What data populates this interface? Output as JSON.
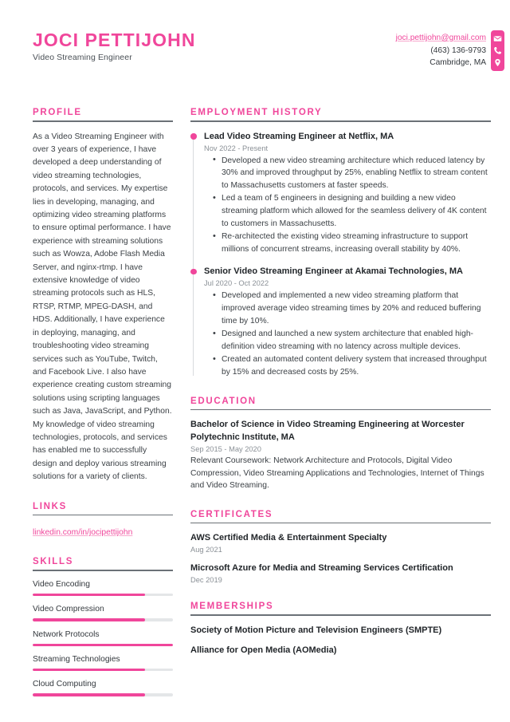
{
  "theme": {
    "accent": "#f0469b",
    "rule": "#6b7177",
    "body_text": "#3b4045",
    "muted_text": "#8a9096",
    "track": "#e4e6e8"
  },
  "header": {
    "full_name": "JOCI PETTIJOHN",
    "job_title": "Video Streaming Engineer",
    "contact": {
      "email": "joci.pettijohn@gmail.com",
      "phone": "(463) 136-9793",
      "location": "Cambridge, MA",
      "icons": [
        "envelope-icon",
        "phone-icon",
        "location-pin-icon"
      ]
    }
  },
  "sidebar": {
    "profile": {
      "heading": "PROFILE",
      "text": "As a Video Streaming Engineer with over 3 years of experience, I have developed a deep understanding of video streaming technologies, protocols, and services. My expertise lies in developing, managing, and optimizing video streaming platforms to ensure optimal performance. I have experience with streaming solutions such as Wowza, Adobe Flash Media Server, and nginx-rtmp. I have extensive knowledge of video streaming protocols such as HLS, RTSP, RTMP, MPEG-DASH, and HDS. Additionally, I have experience in deploying, managing, and troubleshooting video streaming services such as YouTube, Twitch, and Facebook Live. I also have experience creating custom streaming solutions using scripting languages such as Java, JavaScript, and Python. My knowledge of video streaming technologies, protocols, and services has enabled me to successfully design and deploy various streaming solutions for a variety of clients."
    },
    "links": {
      "heading": "LINKS",
      "items": [
        {
          "label": "linkedin.com/in/jocipettijohn"
        }
      ]
    },
    "skills": {
      "heading": "SKILLS",
      "items": [
        {
          "name": "Video Encoding",
          "level": 80
        },
        {
          "name": "Video Compression",
          "level": 80
        },
        {
          "name": "Network Protocols",
          "level": 100
        },
        {
          "name": "Streaming Technologies",
          "level": 80
        },
        {
          "name": "Cloud Computing",
          "level": 80
        }
      ]
    }
  },
  "main": {
    "employment": {
      "heading": "EMPLOYMENT HISTORY",
      "jobs": [
        {
          "role": "Lead Video Streaming Engineer at Netflix, MA",
          "dates": "Nov 2022 - Present",
          "bullets": [
            "Developed a new video streaming architecture which reduced latency by 30% and improved throughput by 25%, enabling Netflix to stream content to Massachusetts customers at faster speeds.",
            "Led a team of 5 engineers in designing and building a new video streaming platform which allowed for the seamless delivery of 4K content to customers in Massachusetts.",
            "Re-architected the existing video streaming infrastructure to support millions of concurrent streams, increasing overall stability by 40%."
          ]
        },
        {
          "role": "Senior Video Streaming Engineer at Akamai Technologies, MA",
          "dates": "Jul 2020 - Oct 2022",
          "bullets": [
            "Developed and implemented a new video streaming platform that improved average video streaming times by 20% and reduced buffering time by 10%.",
            "Designed and launched a new system architecture that enabled high-definition video streaming with no latency across multiple devices.",
            "Created an automated content delivery system that increased throughput by 15% and decreased costs by 25%."
          ]
        }
      ]
    },
    "education": {
      "heading": "EDUCATION",
      "entries": [
        {
          "degree": "Bachelor of Science in Video Streaming Engineering at Worcester Polytechnic Institute, MA",
          "dates": "Sep 2015 - May 2020",
          "description": "Relevant Coursework: Network Architecture and Protocols, Digital Video Compression, Video Streaming Applications and Technologies, Internet of Things and Video Streaming."
        }
      ]
    },
    "certificates": {
      "heading": "CERTIFICATES",
      "entries": [
        {
          "name": "AWS Certified Media & Entertainment Specialty",
          "date": "Aug 2021"
        },
        {
          "name": "Microsoft Azure for Media and Streaming Services Certification",
          "date": "Dec 2019"
        }
      ]
    },
    "memberships": {
      "heading": "MEMBERSHIPS",
      "entries": [
        {
          "name": "Society of Motion Picture and Television Engineers (SMPTE)"
        },
        {
          "name": "Alliance for Open Media (AOMedia)"
        }
      ]
    }
  }
}
